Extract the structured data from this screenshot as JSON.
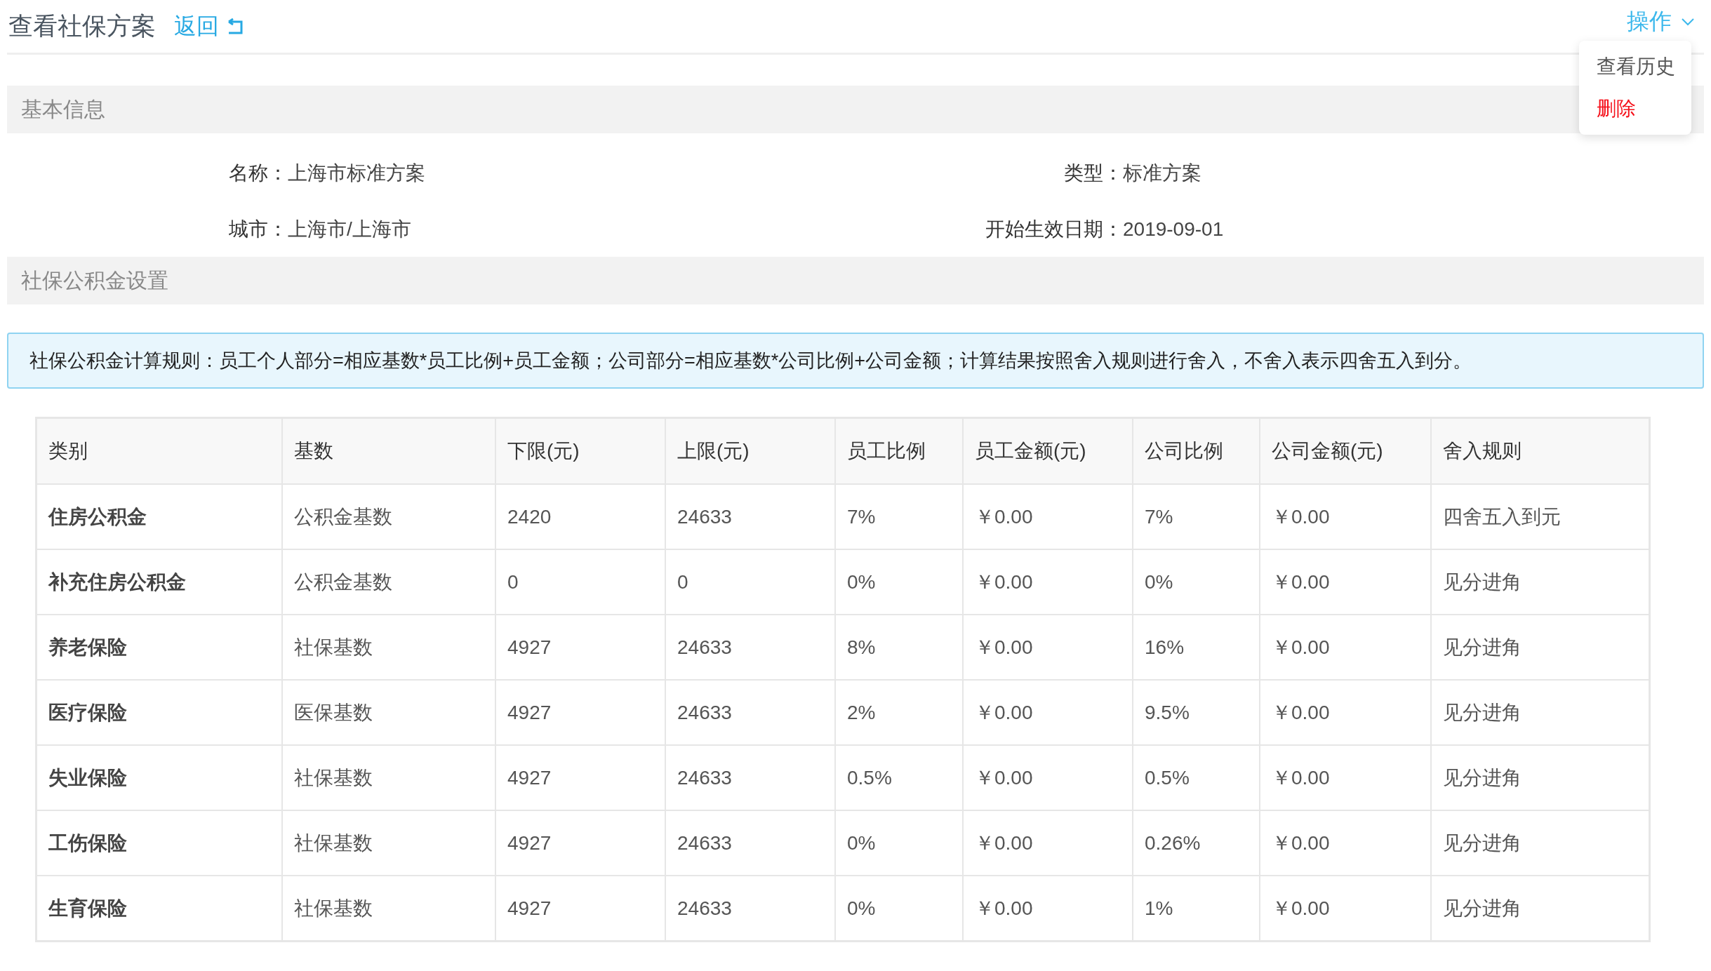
{
  "header": {
    "title": "查看社保方案",
    "back_link": "返回",
    "actions_label": "操作"
  },
  "actions_menu": [
    {
      "label": "查看历史",
      "kind": "normal"
    },
    {
      "label": "删除",
      "kind": "danger"
    }
  ],
  "basic_info": {
    "heading": "基本信息",
    "fields": [
      {
        "label": "名称：",
        "value": "上海市标准方案"
      },
      {
        "label": "类型：",
        "value": "标准方案"
      },
      {
        "label": "城市：",
        "value": "上海市/上海市"
      },
      {
        "label": "开始生效日期：",
        "value": "2019-09-01"
      }
    ]
  },
  "settings": {
    "heading": "社保公积金设置",
    "notice": "社保公积金计算规则：员工个人部分=相应基数*员工比例+员工金额；公司部分=相应基数*公司比例+公司金额；计算结果按照舍入规则进行舍入，不舍入表示四舍五入到分。"
  },
  "table": {
    "columns": [
      "类别",
      "基数",
      "下限(元)",
      "上限(元)",
      "员工比例",
      "员工金额(元)",
      "公司比例",
      "公司金额(元)",
      "舍入规则"
    ],
    "rows": [
      [
        "住房公积金",
        "公积金基数",
        "2420",
        "24633",
        "7%",
        "￥0.00",
        "7%",
        "￥0.00",
        "四舍五入到元"
      ],
      [
        "补充住房公积金",
        "公积金基数",
        "0",
        "0",
        "0%",
        "￥0.00",
        "0%",
        "￥0.00",
        "见分进角"
      ],
      [
        "养老保险",
        "社保基数",
        "4927",
        "24633",
        "8%",
        "￥0.00",
        "16%",
        "￥0.00",
        "见分进角"
      ],
      [
        "医疗保险",
        "医保基数",
        "4927",
        "24633",
        "2%",
        "￥0.00",
        "9.5%",
        "￥0.00",
        "见分进角"
      ],
      [
        "失业保险",
        "社保基数",
        "4927",
        "24633",
        "0.5%",
        "￥0.00",
        "0.5%",
        "￥0.00",
        "见分进角"
      ],
      [
        "工伤保险",
        "社保基数",
        "4927",
        "24633",
        "0%",
        "￥0.00",
        "0.26%",
        "￥0.00",
        "见分进角"
      ],
      [
        "生育保险",
        "社保基数",
        "4927",
        "24633",
        "0%",
        "￥0.00",
        "1%",
        "￥0.00",
        "见分进角"
      ]
    ]
  }
}
